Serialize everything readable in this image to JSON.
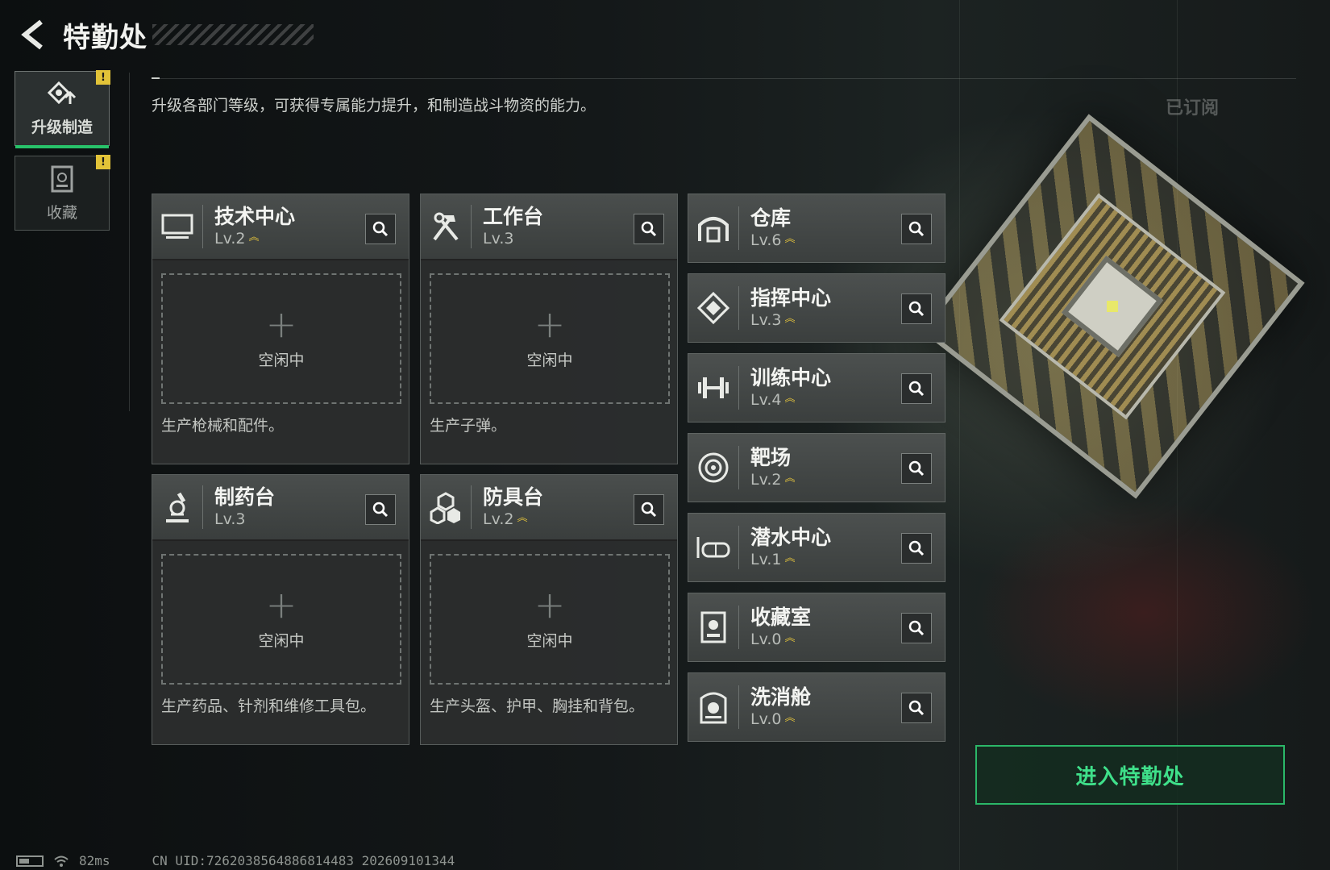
{
  "header": {
    "title": "特勤处"
  },
  "sidebar": {
    "tabs": [
      {
        "label": "升级制造",
        "active": true,
        "alert": "!"
      },
      {
        "label": "收藏",
        "active": false,
        "alert": "!"
      }
    ]
  },
  "description": "升级各部门等级，可获得专属能力提升，和制造战斗物资的能力。",
  "subscribed_label": "已订阅",
  "production_cards": [
    {
      "name": "技术中心",
      "level": "Lv.2",
      "upgradeable": true,
      "slot_label": "空闲中",
      "desc": "生产枪械和配件。"
    },
    {
      "name": "工作台",
      "level": "Lv.3",
      "upgradeable": false,
      "slot_label": "空闲中",
      "desc": "生产子弹。"
    },
    {
      "name": "制药台",
      "level": "Lv.3",
      "upgradeable": false,
      "slot_label": "空闲中",
      "desc": "生产药品、针剂和维修工具包。"
    },
    {
      "name": "防具台",
      "level": "Lv.2",
      "upgradeable": true,
      "slot_label": "空闲中",
      "desc": "生产头盔、护甲、胸挂和背包。"
    }
  ],
  "facilities": [
    {
      "name": "仓库",
      "level": "Lv.6",
      "upgradeable": true
    },
    {
      "name": "指挥中心",
      "level": "Lv.3",
      "upgradeable": true
    },
    {
      "name": "训练中心",
      "level": "Lv.4",
      "upgradeable": true
    },
    {
      "name": "靶场",
      "level": "Lv.2",
      "upgradeable": true
    },
    {
      "name": "潜水中心",
      "level": "Lv.1",
      "upgradeable": true
    },
    {
      "name": "收藏室",
      "level": "Lv.0",
      "upgradeable": true
    },
    {
      "name": "洗消舱",
      "level": "Lv.0",
      "upgradeable": true
    }
  ],
  "enter_button": {
    "label": "进入特勤处"
  },
  "status_bar": {
    "ping": "82ms",
    "uid": "CN UID:7262038564886814483 202609101344"
  },
  "colors": {
    "accent_green": "#2bb768",
    "upgrade_gold": "#e2c23c",
    "alert_yellow": "#e2c338"
  },
  "icons": {
    "back": "chevron-left-icon",
    "upgrade_tab": "upgrade-gear-icon",
    "collection_tab": "collection-case-icon",
    "search": "magnifier-icon",
    "tech_center": "monitor-icon",
    "workbench": "hammer-wrench-icon",
    "pharmacy": "microscope-icon",
    "armor_bench": "armor-cubes-icon",
    "warehouse": "warehouse-icon",
    "command_center": "command-diamond-icon",
    "training_center": "dumbbell-icon",
    "shooting_range": "target-icon",
    "diving_center": "diving-mask-icon",
    "collection_room": "display-case-icon",
    "decon_chamber": "biohazard-chamber-icon"
  }
}
